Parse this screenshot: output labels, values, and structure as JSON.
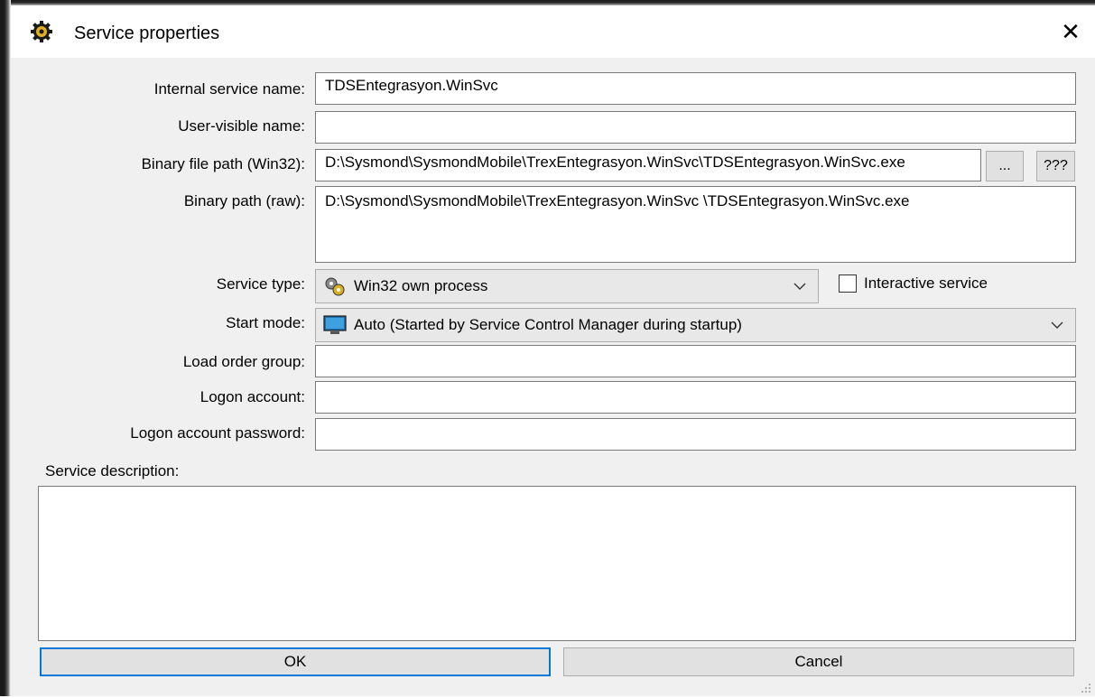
{
  "window": {
    "title": "Service properties",
    "app_icon": "gear-icon",
    "close_glyph": "✕"
  },
  "form": {
    "internal_name": {
      "label": "Internal service name:",
      "value": "TDSEntegrasyon.WinSvc"
    },
    "user_visible_name": {
      "label": "User-visible name:",
      "value": ""
    },
    "binary_path_win32": {
      "label": "Binary file path (Win32):",
      "value": "D:\\Sysmond\\SysmondMobile\\TrexEntegrasyon.WinSvc\\TDSEntegrasyon.WinSvc.exe",
      "browse_label": "...",
      "help_label": "???"
    },
    "binary_path_raw": {
      "label": "Binary path (raw):",
      "value": "D:\\Sysmond\\SysmondMobile\\TrexEntegrasyon.WinSvc \\TDSEntegrasyon.WinSvc.exe"
    },
    "service_type": {
      "label": "Service type:",
      "selected": "Win32 own process",
      "icon": "gears-icon"
    },
    "interactive_service": {
      "label": "Interactive service",
      "checked": false
    },
    "start_mode": {
      "label": "Start mode:",
      "selected": "Auto (Started by Service Control Manager during startup)",
      "icon": "monitor-icon"
    },
    "load_order_group": {
      "label": "Load order group:",
      "value": ""
    },
    "logon_account": {
      "label": "Logon account:",
      "value": ""
    },
    "logon_password": {
      "label": "Logon account password:",
      "value": ""
    },
    "description": {
      "label": "Service description:",
      "value": ""
    }
  },
  "buttons": {
    "ok": "OK",
    "cancel": "Cancel"
  },
  "colors": {
    "accent": "#0078d7",
    "dialog_bg": "#f0f0f0"
  }
}
